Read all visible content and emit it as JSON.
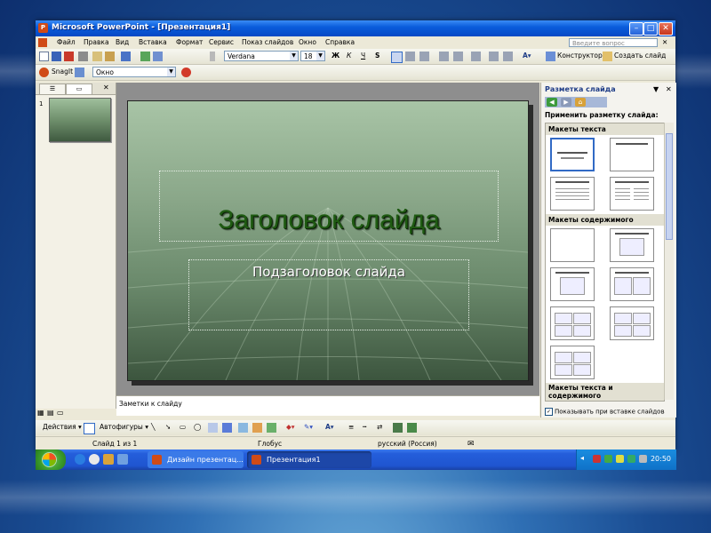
{
  "window": {
    "title": "Microsoft PowerPoint - [Презентация1]",
    "app_icon_letter": "P"
  },
  "menu": {
    "items": [
      "Файл",
      "Правка",
      "Вид",
      "Вставка",
      "Формат",
      "Сервис",
      "Показ слайдов",
      "Окно",
      "Справка"
    ],
    "ask_placeholder": "Введите вопрос"
  },
  "toolbar": {
    "font_name": "Verdana",
    "font_size": "18",
    "bold": "Ж",
    "italic": "К",
    "underline": "Ч",
    "shadow": "S",
    "designer_label": "Конструктор",
    "new_slide_label": "Создать слайд",
    "snagit_label": "SnagIt",
    "window_combo": "Окно"
  },
  "outline": {
    "slide_number": "1"
  },
  "slide": {
    "title": "Заголовок слайда",
    "subtitle": "Подзаголовок слайда"
  },
  "notes": {
    "placeholder": "Заметки к слайду"
  },
  "task_pane": {
    "header": "Разметка слайда",
    "apply_label": "Применить разметку слайда:",
    "section_text": "Макеты текста",
    "section_content": "Макеты содержимого",
    "section_text_content": "Макеты текста и содержимого",
    "show_on_insert": "Показывать при вставке слайдов",
    "show_on_insert_checked": true
  },
  "drawing": {
    "actions_label": "Действия",
    "autoshapes_label": "Автофигуры"
  },
  "status": {
    "slide_info": "Слайд 1 из 1",
    "design": "Глобус",
    "language": "русский (Россия)"
  },
  "taskbar": {
    "apps": [
      {
        "label": "Дизайн презентац...",
        "active": false
      },
      {
        "label": "Презентация1",
        "active": true
      }
    ],
    "clock": "20:50"
  }
}
